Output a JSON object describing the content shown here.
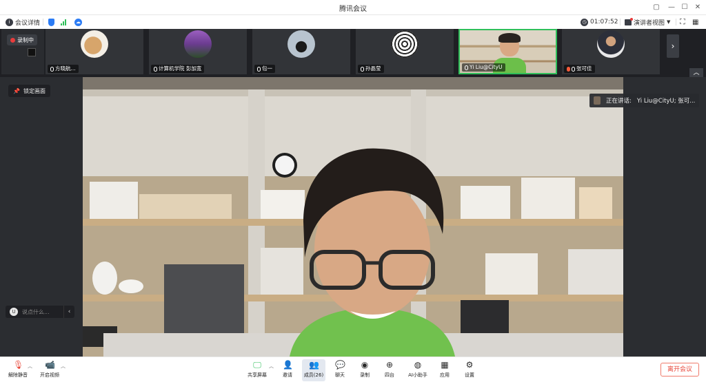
{
  "window": {
    "title": "腾讯会议"
  },
  "infobar": {
    "meeting_details": "会议详情",
    "timer": "01:07:52",
    "view_mode": "演讲者视图"
  },
  "recording": {
    "label": "录制中"
  },
  "participants": [
    {
      "name": "方晓航..."
    },
    {
      "name": "计算机学院 彭加宽"
    },
    {
      "name": "包一"
    },
    {
      "name": "孙晶莹"
    },
    {
      "name": "Yi Liu@CityU"
    },
    {
      "name": "张可佳"
    }
  ],
  "side": {
    "lock_screen": "锁定画面",
    "chat_placeholder": "说点什么..."
  },
  "speaking": {
    "prefix": "正在讲话:",
    "names": "Yi Liu@CityU; 张可..."
  },
  "toolbar": {
    "unmute": "解除静音",
    "start_video": "开启视频",
    "share_screen": "共享屏幕",
    "invite": "邀请",
    "members": "成员(26)",
    "chat": "聊天",
    "record": "录制",
    "apps_view": "四台",
    "ai_assistant": "AI小助手",
    "apps": "应用",
    "settings": "设置",
    "leave": "离开会议"
  },
  "colors": {
    "accent": "#2b7cf5",
    "active_speaker": "#2fbf5a",
    "leave": "#e8473a"
  }
}
